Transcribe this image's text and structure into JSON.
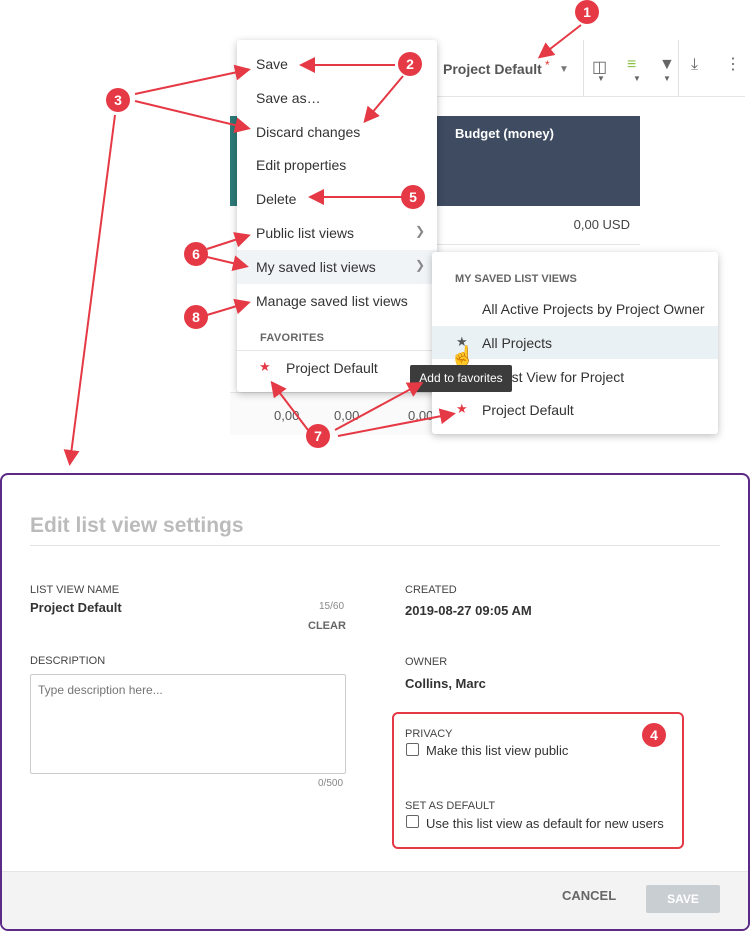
{
  "toolbar": {
    "view_name": "Project Default",
    "modified_marker": "*"
  },
  "table": {
    "budget_header": "Budget (money)",
    "budget_value": "0,00 USD",
    "row_values": [
      "0,00",
      "0,00",
      "0,00"
    ]
  },
  "menu": {
    "items": [
      {
        "label": "Save"
      },
      {
        "label": "Save as…"
      },
      {
        "label": "Discard changes"
      },
      {
        "label": "Edit properties"
      },
      {
        "label": "Delete"
      },
      {
        "label": "Public list views"
      },
      {
        "label": "My saved list views"
      },
      {
        "label": "Manage saved list views"
      }
    ],
    "favorites_header": "FAVORITES",
    "favorite_item": "Project Default"
  },
  "submenu": {
    "header": "MY SAVED LIST VIEWS",
    "items": [
      {
        "label": "All Active Projects by Project Owner"
      },
      {
        "label": "All Projects"
      },
      {
        "label": "ult List View for Project"
      },
      {
        "label": "Project Default"
      }
    ]
  },
  "tooltip": "Add to favorites",
  "dialog": {
    "title": "Edit list view settings",
    "name_label": "LIST VIEW NAME",
    "name_value": "Project Default",
    "name_count": "15/60",
    "clear_label": "CLEAR",
    "description_label": "DESCRIPTION",
    "description_placeholder": "Type description here...",
    "description_count": "0/500",
    "created_label": "CREATED",
    "created_value": "2019-08-27 09:05 AM",
    "owner_label": "OWNER",
    "owner_value": "Collins, Marc",
    "privacy_label": "PRIVACY",
    "privacy_checkbox": "Make this list view public",
    "default_label": "SET AS DEFAULT",
    "default_checkbox": "Use this list view as default for new users",
    "cancel_label": "CANCEL",
    "save_label": "SAVE"
  },
  "callouts": [
    "1",
    "2",
    "3",
    "4",
    "5",
    "6",
    "7",
    "8"
  ],
  "colors": {
    "accent_red": "#e53945",
    "header_dark": "#3e4b60",
    "teal": "#2d7a78",
    "dialog_border": "#5b2a86"
  }
}
